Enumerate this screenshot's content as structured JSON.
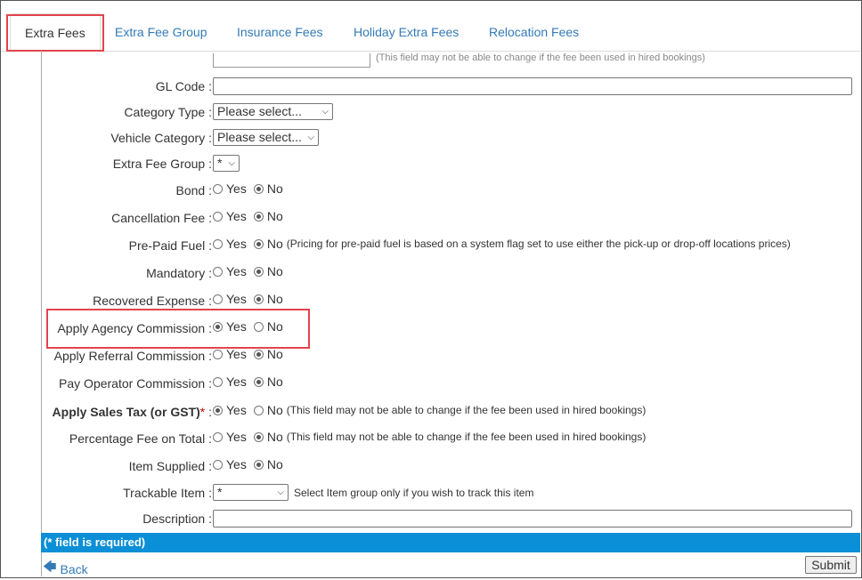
{
  "tabs": [
    {
      "label": "Extra Fees",
      "active": true
    },
    {
      "label": "Extra Fee Group",
      "active": false
    },
    {
      "label": "Insurance Fees",
      "active": false
    },
    {
      "label": "Holiday Extra Fees",
      "active": false
    },
    {
      "label": "Relocation Fees",
      "active": false
    }
  ],
  "top_cut": {
    "note": "(This field may not be able to change if the fee been used in hired bookings)"
  },
  "radio_labels": {
    "yes": "Yes",
    "no": "No"
  },
  "fields": {
    "gl_code": {
      "label": "GL Code :",
      "value": ""
    },
    "category_type": {
      "label": "Category Type :",
      "value": "Please select..."
    },
    "vehicle_category": {
      "label": "Vehicle Category :",
      "value": "Please select..."
    },
    "extra_fee_group": {
      "label": "Extra Fee Group :",
      "value": "*"
    },
    "bond": {
      "label": "Bond :",
      "selected": "No"
    },
    "cancellation_fee": {
      "label": "Cancellation Fee :",
      "selected": "No"
    },
    "pre_paid_fuel": {
      "label": "Pre-Paid Fuel :",
      "selected": "No",
      "note": "(Pricing for pre-paid fuel is based on a system flag set to use either the pick-up or drop-off locations prices)"
    },
    "mandatory": {
      "label": "Mandatory :",
      "selected": "No"
    },
    "recovered_expense": {
      "label": "Recovered Expense :",
      "selected": "No"
    },
    "apply_agency_commission": {
      "label": "Apply Agency Commission :",
      "selected": "Yes"
    },
    "apply_referral_commission": {
      "label": "Apply Referral Commission :",
      "selected": "No"
    },
    "pay_operator_commission": {
      "label": "Pay Operator Commission :",
      "selected": "No"
    },
    "apply_sales_tax": {
      "label": "Apply Sales Tax (or GST)",
      "required_mark": "*",
      "colon": ":",
      "selected": "Yes",
      "note": "(This field may not be able to change if the fee been used in hired bookings)"
    },
    "percentage_fee": {
      "label": "Percentage Fee on Total :",
      "selected": "No",
      "note": "(This field may not be able to change if the fee been used in hired bookings)"
    },
    "item_supplied": {
      "label": "Item Supplied :",
      "selected": "No"
    },
    "trackable_item": {
      "label": "Trackable Item :",
      "value": "*",
      "note": "Select Item group only if you wish to track this item"
    },
    "description": {
      "label": "Description :",
      "value": ""
    }
  },
  "footer": {
    "required_note": "(* field is required)",
    "back_label": "Back",
    "submit_label": "Submit"
  },
  "colors": {
    "accent": "#0b8fd6",
    "link": "#337ab7",
    "highlight": "#e2434b"
  },
  "icons": {
    "back": "arrow-left-icon",
    "dropdown": "chevron-down-icon"
  }
}
